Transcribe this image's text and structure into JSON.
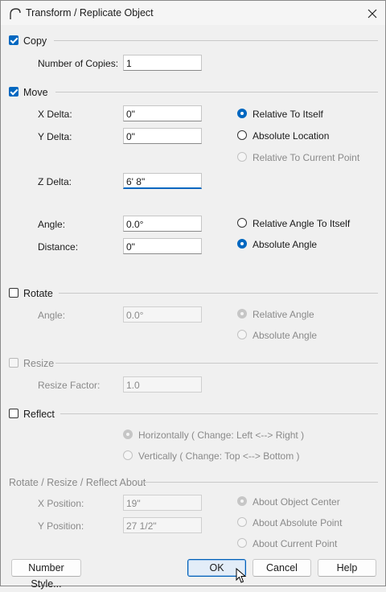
{
  "window": {
    "title": "Transform / Replicate Object"
  },
  "copy": {
    "label": "Copy",
    "checked": true,
    "number_of_copies_label": "Number of Copies:",
    "number_of_copies": "1"
  },
  "move": {
    "label": "Move",
    "checked": true,
    "x_delta_label": "X Delta:",
    "x_delta": "0\"",
    "y_delta_label": "Y Delta:",
    "y_delta": "0\"",
    "z_delta_label": "Z Delta:",
    "z_delta": "6' 8\"",
    "angle_label": "Angle:",
    "angle": "0.0°",
    "distance_label": "Distance:",
    "distance": "0\"",
    "relative_to_itself": "Relative To Itself",
    "absolute_location": "Absolute Location",
    "relative_to_current_point": "Relative To Current Point",
    "relative_angle_to_itself": "Relative Angle To Itself",
    "absolute_angle": "Absolute Angle"
  },
  "rotate": {
    "label": "Rotate",
    "checked": false,
    "angle_label": "Angle:",
    "angle": "0.0°",
    "relative_angle": "Relative Angle",
    "absolute_angle": "Absolute Angle"
  },
  "resize": {
    "label": "Resize",
    "checked": false,
    "factor_label": "Resize Factor:",
    "factor": "1.0"
  },
  "reflect": {
    "label": "Reflect",
    "checked": false,
    "horizontally": "Horizontally ( Change: Left <--> Right )",
    "vertically": "Vertically ( Change: Top <--> Bottom )"
  },
  "about": {
    "label": "Rotate / Resize / Reflect About",
    "x_position_label": "X Position:",
    "x_position": "19\"",
    "y_position_label": "Y Position:",
    "y_position": "27 1/2\"",
    "about_object_center": "About Object Center",
    "about_absolute_point": "About Absolute Point",
    "about_current_point": "About Current Point"
  },
  "buttons": {
    "number_style": "Number Style...",
    "ok": "OK",
    "cancel": "Cancel",
    "help": "Help"
  },
  "colors": {
    "accent": "#0067c0",
    "disabled_text": "#8a8a8a"
  }
}
